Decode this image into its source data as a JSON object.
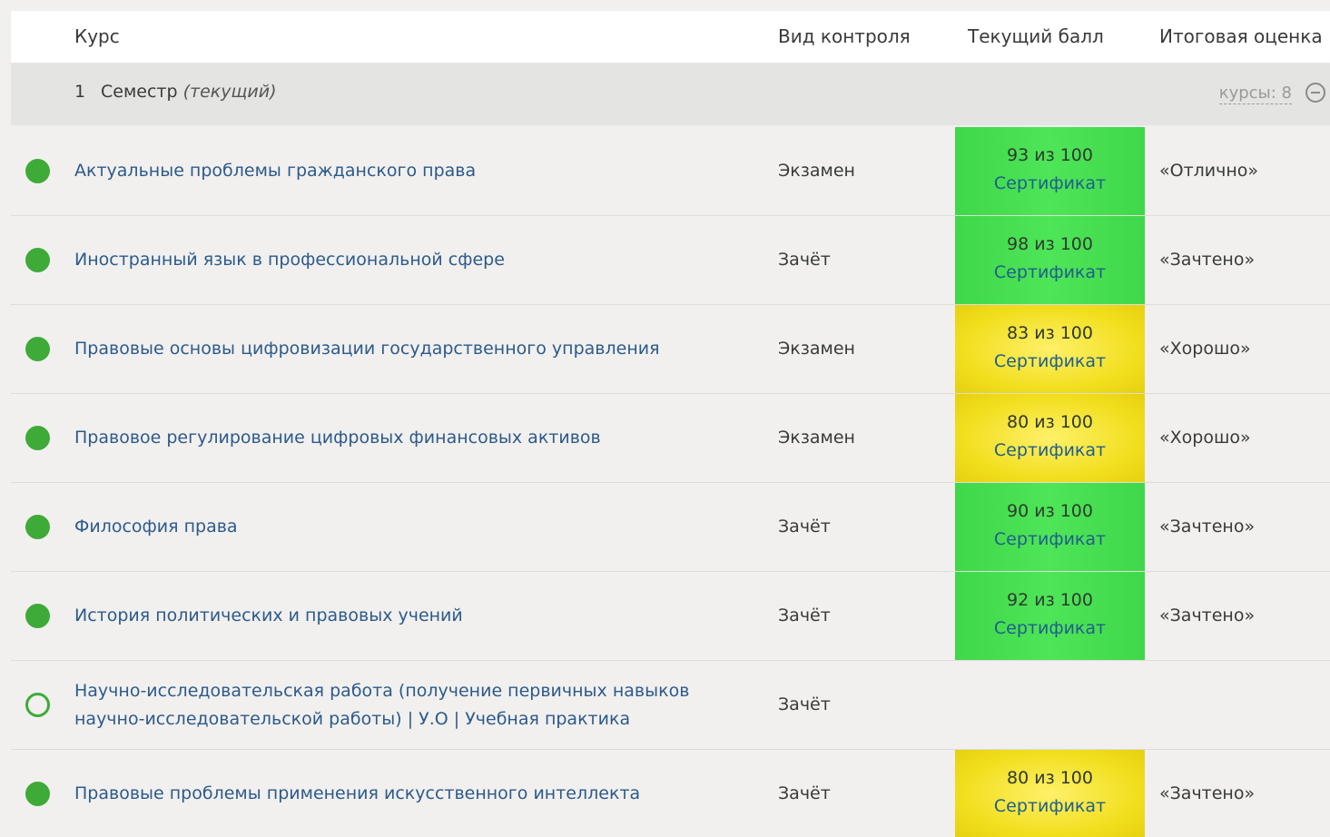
{
  "header": {
    "course": "Курс",
    "control_type": "Вид контроля",
    "current_score": "Текущий балл",
    "final_grade": "Итоговая оценка"
  },
  "semester": {
    "number": "1",
    "title": "Семестр",
    "current_label": "(текущий)",
    "courses_count": "курсы: 8"
  },
  "courses": [
    {
      "status": "done",
      "name": "Актуальные проблемы гражданского права",
      "control": "Экзамен",
      "score": "93 из 100",
      "certificate": "Сертификат",
      "score_color": "green",
      "grade": "«Отлично»"
    },
    {
      "status": "done",
      "name": "Иностранный язык в профессиональной сфере",
      "control": "Зачёт",
      "score": "98 из 100",
      "certificate": "Сертификат",
      "score_color": "green",
      "grade": "«Зачтено»"
    },
    {
      "status": "done",
      "name": "Правовые основы цифровизации государственного управления",
      "control": "Экзамен",
      "score": "83 из 100",
      "certificate": "Сертификат",
      "score_color": "yellow",
      "grade": "«Хорошо»"
    },
    {
      "status": "done",
      "name": "Правовое регулирование цифровых финансовых активов",
      "control": "Экзамен",
      "score": "80 из 100",
      "certificate": "Сертификат",
      "score_color": "yellow",
      "grade": "«Хорошо»"
    },
    {
      "status": "done",
      "name": "Философия права",
      "control": "Зачёт",
      "score": "90 из 100",
      "certificate": "Сертификат",
      "score_color": "green",
      "grade": "«Зачтено»"
    },
    {
      "status": "done",
      "name": "История политических и правовых учений",
      "control": "Зачёт",
      "score": "92 из 100",
      "certificate": "Сертификат",
      "score_color": "green",
      "grade": "«Зачтено»"
    },
    {
      "status": "pending",
      "name": "Научно-исследовательская работа (получение первичных навыков научно-исследовательской работы) | У.О | Учебная практика",
      "control": "Зачёт",
      "score": "",
      "certificate": "",
      "score_color": "none",
      "grade": ""
    },
    {
      "status": "done",
      "name": "Правовые проблемы применения искусственного интеллекта",
      "control": "Зачёт",
      "score": "80 из 100",
      "certificate": "Сертификат",
      "score_color": "yellow",
      "grade": "«Зачтено»"
    }
  ],
  "colors": {
    "status_green": "#3eaa38",
    "score_green": "#4ee558",
    "score_yellow": "#f1df1e",
    "link": "#2d5a8c"
  }
}
